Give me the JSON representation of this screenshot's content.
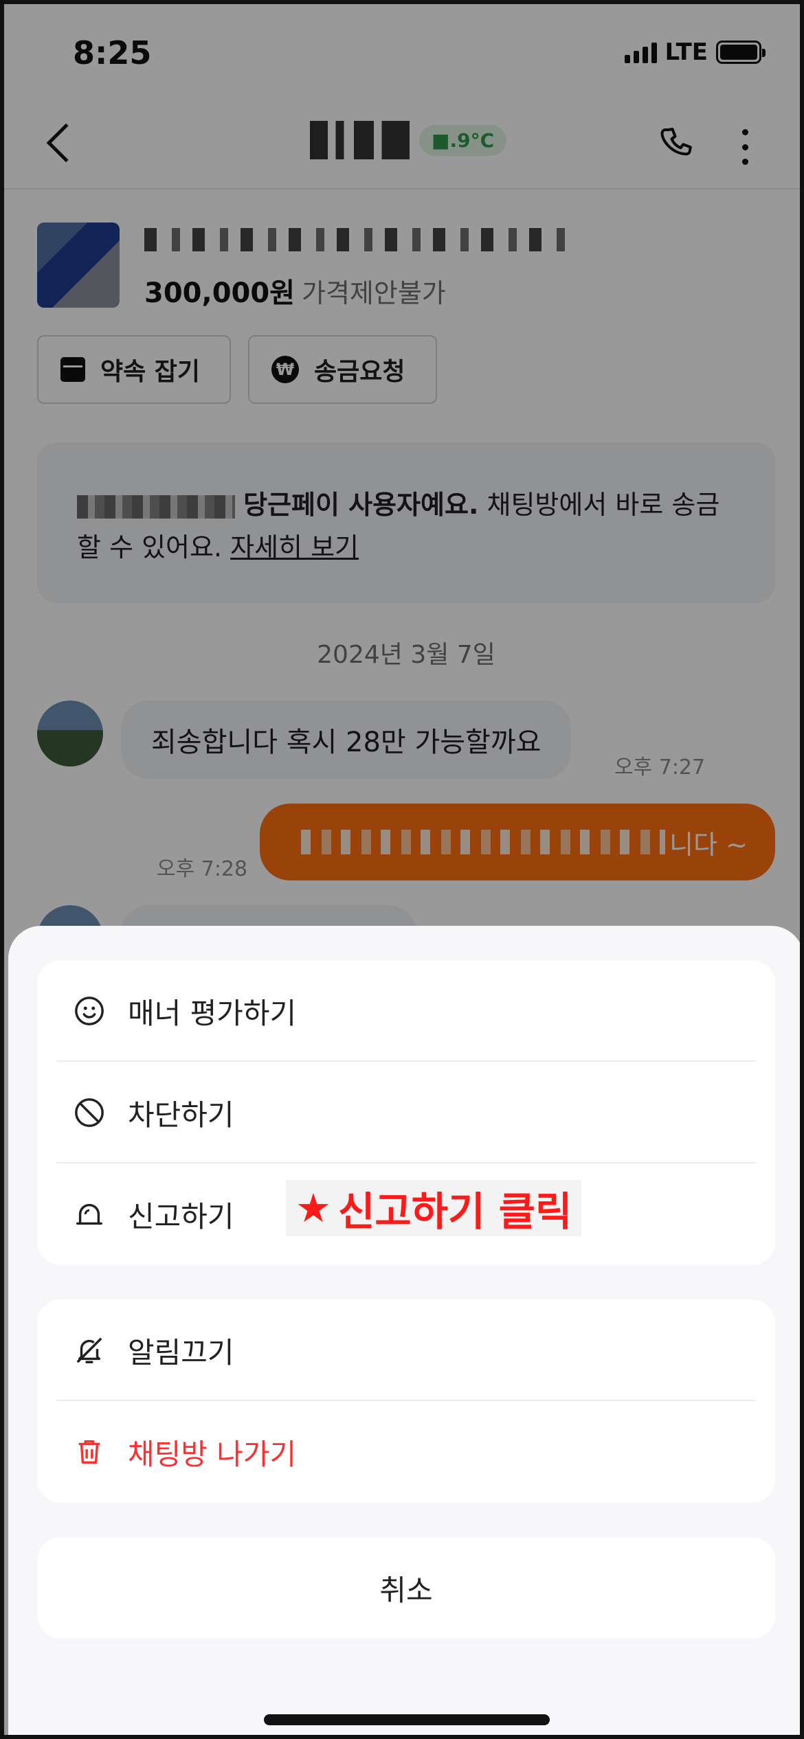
{
  "status_bar": {
    "time": "8:25",
    "network": "LTE"
  },
  "header": {
    "temperature": "■.9°C"
  },
  "product": {
    "price": "300,000원",
    "negotiation": "가격제안불가"
  },
  "actions": {
    "appointment_label": "약속 잡기",
    "remit_label": "송금요청",
    "won_symbol": "₩"
  },
  "notice": {
    "bold_text": "당근페이 사용자예요.",
    "text": " 채팅방에서 바로 송금할 수 있어요. ",
    "link": "자세히 보기"
  },
  "chat": {
    "date": "2024년 3월 7일",
    "messages": [
      {
        "side": "in",
        "text": "죄송합니다 혹시 28만 가능할까요",
        "time": "오후 7:27"
      },
      {
        "side": "out",
        "text_suffix": "니다 ~",
        "time": "오후 7:28"
      }
    ]
  },
  "sheet": {
    "group1": [
      {
        "icon": "smile-icon",
        "label": "매너 평가하기"
      },
      {
        "icon": "block-icon",
        "label": "차단하기"
      },
      {
        "icon": "siren-icon",
        "label": "신고하기"
      }
    ],
    "group2": [
      {
        "icon": "bell-off-icon",
        "label": "알림끄기"
      },
      {
        "icon": "trash-icon",
        "label": "채팅방 나가기",
        "color": "#ff2f2f"
      }
    ],
    "cancel_label": "취소"
  },
  "annotation": {
    "star": "★",
    "text": "신고하기 클릭",
    "color": "#ff1a1a"
  },
  "colors": {
    "accent_orange": "#ff6f0f",
    "danger_red": "#ff2f2f",
    "temperature_green": "#2f9a4a"
  }
}
